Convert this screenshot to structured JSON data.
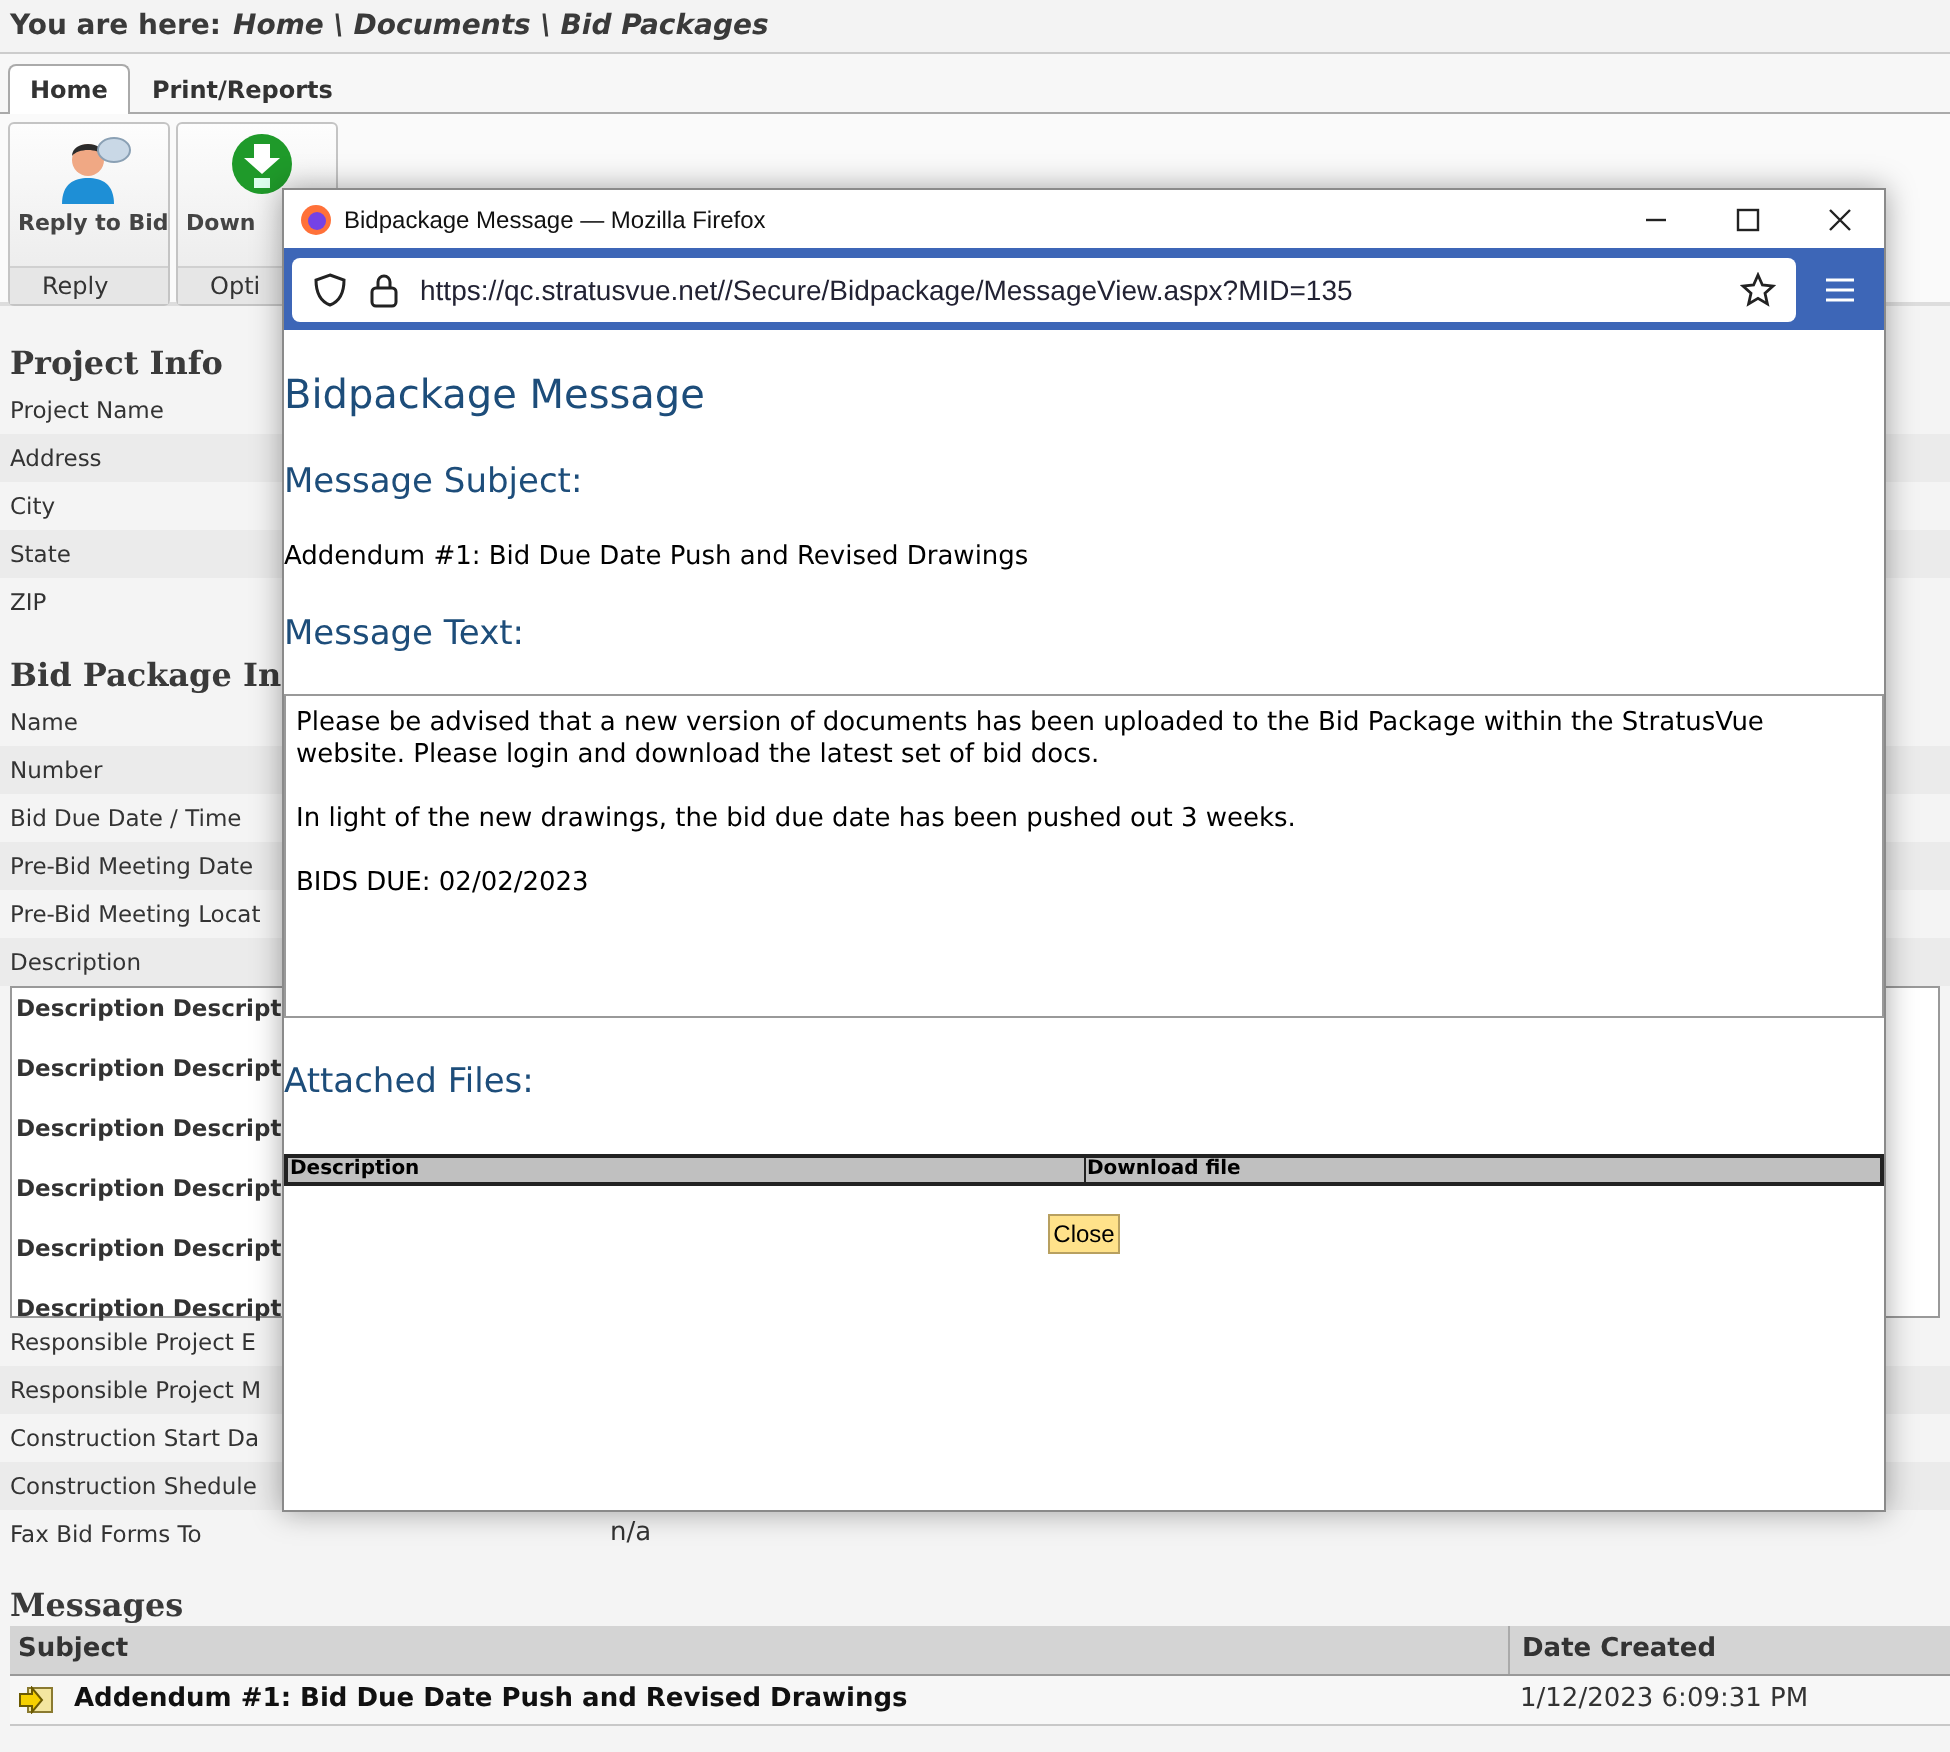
{
  "breadcrumb": {
    "label": "You are here:",
    "path": "Home \\ Documents \\ Bid Packages"
  },
  "tabs": [
    {
      "label": "Home",
      "selected": true
    },
    {
      "label": "Print/Reports",
      "selected": false
    }
  ],
  "ribbon_groups": [
    {
      "label": "Reply",
      "button": {
        "label": "Reply to Bid"
      }
    },
    {
      "label": "Opti",
      "button": {
        "label": "Down"
      }
    }
  ],
  "sections": [
    {
      "title": "Project Info",
      "rows": [
        {
          "kind": "field",
          "label": "Project Name"
        },
        {
          "kind": "field",
          "label": "Address"
        },
        {
          "kind": "field",
          "label": "City"
        },
        {
          "kind": "field",
          "label": "State"
        },
        {
          "kind": "field",
          "label": "ZIP"
        }
      ]
    },
    {
      "title": "Bid Package In",
      "rows": [
        {
          "kind": "field",
          "label": "Name"
        },
        {
          "kind": "field",
          "label": "Number"
        },
        {
          "kind": "field",
          "label": "Bid Due Date / Time"
        },
        {
          "kind": "field",
          "label": "Pre-Bid Meeting Date"
        },
        {
          "kind": "field",
          "label": "Pre-Bid Meeting Locat"
        },
        {
          "kind": "field",
          "label": "Description"
        },
        {
          "kind": "text_box",
          "lines": [
            "Description Descript",
            "Description Descript",
            "Description Descript",
            "Description Descript",
            "Description Descript",
            "Description Descript"
          ]
        },
        {
          "kind": "field",
          "label": "Responsible Project E"
        },
        {
          "kind": "field",
          "label": "Responsible Project M"
        },
        {
          "kind": "field",
          "label": "Construction Start Da"
        },
        {
          "kind": "field",
          "label": "Construction Shedule"
        },
        {
          "kind": "field",
          "label": "Fax Bid Forms To",
          "value": "n/a"
        }
      ]
    }
  ],
  "messages": {
    "title": "Messages",
    "columns": [
      "Subject",
      "Date Created"
    ],
    "rows": [
      {
        "subject": "Addendum #1: Bid Due Date Push and Revised Drawings",
        "date": "1/12/2023 6:09:31 PM"
      }
    ]
  },
  "popup": {
    "title": "Bidpackage Message — Mozilla Firefox",
    "url": "https://qc.stratusvue.net//Secure/Bidpackage/MessageView.aspx?MID=135",
    "heading": "Bidpackage Message",
    "subject_label": "Message Subject:",
    "subject": "Addendum #1: Bid Due Date Push and Revised Drawings",
    "text_label": "Message Text:",
    "paragraphs": [
      "Please be advised that a new version of documents has been uploaded to the Bid Package within the StratusVue website. Please login and download the latest set of bid docs.",
      "In light of the new drawings, the bid due date has been pushed out 3 weeks.",
      "BIDS DUE: 02/02/2023"
    ],
    "files_label": "Attached Files:",
    "files_columns": [
      "Description",
      "Download file"
    ],
    "close": "Close"
  }
}
